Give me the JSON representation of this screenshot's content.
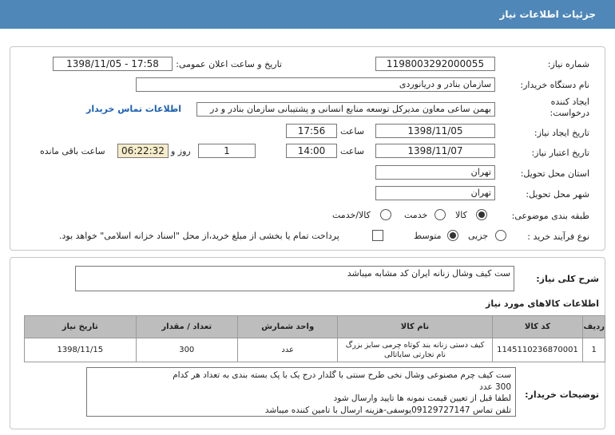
{
  "header": {
    "title": "جزئیات اطلاعات نیاز"
  },
  "form": {
    "need_number_label": "شماره نیاز:",
    "need_number": "1198003292000055",
    "announce_label": "تاریخ و ساعت اعلان عمومی:",
    "announce_value": "1398/11/05 - 17:58",
    "buyer_org_label": "نام دستگاه خریدار:",
    "buyer_org": "سازمان بنادر و دریانوردی",
    "creator_label_1": "ایجاد کننده",
    "creator_label_2": "درخواست:",
    "creator": "بهمن ساعی معاون مدیرکل توسعه منابع انسانی و پشتیبانی سازمان بنادر و در",
    "contact_link": "اطلاعات تماس خریدار",
    "created_date_label": "تاریخ ایجاد نیاز:",
    "created_date": "1398/11/05",
    "time_label": "ساعت",
    "created_time": "17:56",
    "validity_label": "تاریخ اعتبار نیاز:",
    "validity_date": "1398/11/07",
    "validity_time": "14:00",
    "days": "1",
    "days_label": "روز و",
    "remaining": "06:22:32",
    "remaining_label": "ساعت باقی مانده",
    "province_label": "استان محل تحویل:",
    "province": "تهران",
    "city_label": "شهر محل تحویل:",
    "city": "تهران",
    "category_label": "طبقه بندی موضوعی:",
    "category_options": [
      "کالا",
      "خدمت",
      "کالا/خدمت"
    ],
    "category_selected": 0,
    "process_label": "نوع فرآیند خرید :",
    "process_options": [
      "جزیی",
      "متوسط"
    ],
    "process_selected": 1,
    "payment_note": "پرداخت تمام یا بخشی از مبلغ خرید،از محل \"اسناد خزانه اسلامی\" خواهد بود."
  },
  "description": {
    "label": "شرح کلی نیاز:",
    "text": "ست کیف وشال زنانه ایران کد مشابه میباشد"
  },
  "goods": {
    "title": "اطلاعات کالاهای مورد نیاز",
    "columns": [
      "ردیف",
      "کد کالا",
      "نام کالا",
      "واحد شمارش",
      "تعداد / مقدار",
      "تاریخ نیاز"
    ],
    "rows": [
      [
        "1",
        "1145110236870001",
        "کیف دستی زنانه بند کوتاه چرمی سایز بزرگ نام تجارتی سایاتالی",
        "عدد",
        "300",
        "1398/11/15"
      ]
    ]
  },
  "buyer_notes": {
    "label": "توضیحات خریدار:",
    "lines": [
      "ست کیف چرم مصنوعی وشال نخی طرح سنتی با گلدار درج یک با پک بسته بندی به تعداد هر کدام",
      "300 عدد",
      "لطفا قبل از تعیین قیمت نمونه ها تایید وارسال شود",
      "تلفن تماس 09129727147یوسفی-هزینه ارسال با تامین کننده میباشد"
    ]
  },
  "colors": {
    "header": "#4f87b8",
    "link": "#1a5fb4",
    "remaining_bg": "#f5ecc9"
  }
}
